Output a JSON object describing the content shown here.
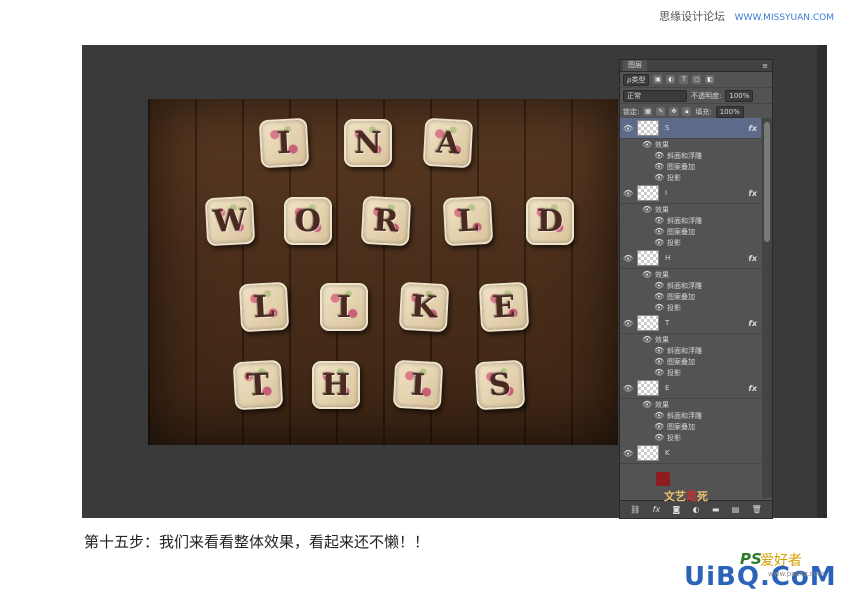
{
  "site_credit": {
    "name": "思缘设计论坛",
    "url": "WWW.MISSYUAN.COM"
  },
  "canvas": {
    "rows": [
      [
        "I",
        "N",
        "A"
      ],
      [
        "W",
        "O",
        "R",
        "L",
        "D"
      ],
      [
        "L",
        "I",
        "K",
        "E"
      ],
      [
        "T",
        "H",
        "I",
        "S"
      ]
    ]
  },
  "layers_panel": {
    "tab_label": "图层",
    "filter_label": "ρ类型",
    "blend_mode": "正常",
    "opacity_label": "不透明度:",
    "opacity_value": "100%",
    "lock_label": "锁定:",
    "fill_label": "填充:",
    "fill_value": "100%",
    "fx_label": "fx",
    "effects_label": "效果",
    "layers": [
      {
        "name": "S",
        "active": true,
        "effects": [
          "斜面和浮雕",
          "图案叠加",
          "投影"
        ]
      },
      {
        "name": "I",
        "active": false,
        "effects": [
          "斜面和浮雕",
          "图案叠加",
          "投影"
        ]
      },
      {
        "name": "H",
        "active": false,
        "effects": [
          "斜面和浮雕",
          "图案叠加",
          "投影"
        ]
      },
      {
        "name": "T",
        "active": false,
        "effects": [
          "斜面和浮雕",
          "图案叠加",
          "投影"
        ]
      },
      {
        "name": "E",
        "active": false,
        "effects": [
          "斜面和浮雕",
          "图案叠加",
          "投影"
        ]
      },
      {
        "name": "K",
        "active": false,
        "effects": []
      }
    ],
    "bottom_icons": [
      "link-icon",
      "fx-icon",
      "mask-icon",
      "adjustment-icon",
      "folder-icon",
      "new-layer-icon",
      "trash-icon"
    ]
  },
  "watermark": {
    "text_a": "文艺",
    "text_b": "范",
    "text_c": "死"
  },
  "caption": "第十五步：我们来看看整体效果，看起来还不懒！！",
  "logo": {
    "ps": "PS",
    "ps_cn": "爱好者",
    "site": "UiBQ.CoM",
    "small": "www.psahz.com"
  }
}
